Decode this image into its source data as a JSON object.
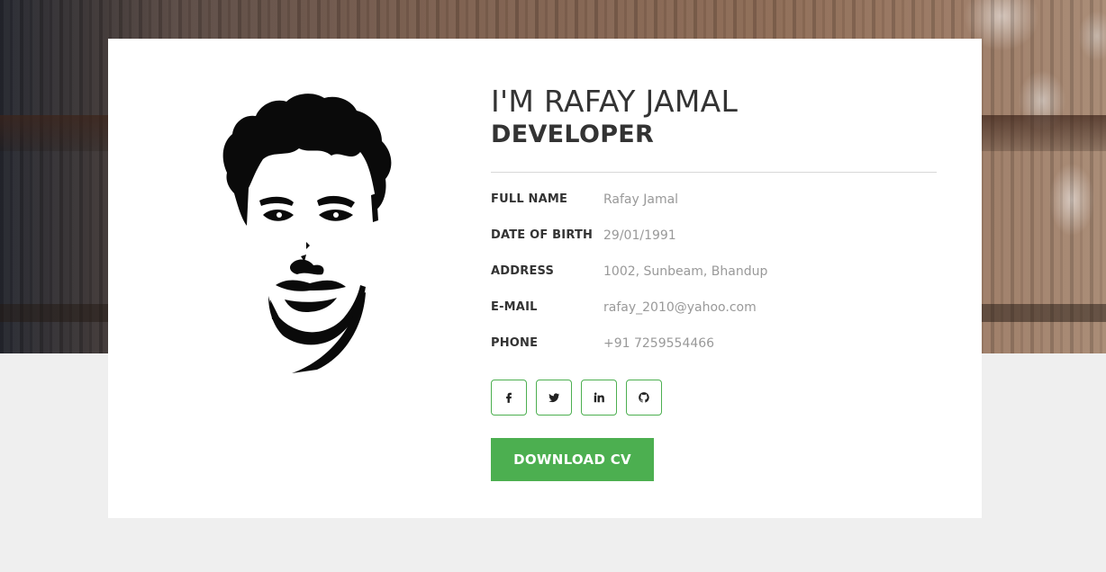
{
  "profile": {
    "title": "I'M RAFAY JAMAL",
    "subtitle": "DEVELOPER"
  },
  "details": [
    {
      "label": "FULL NAME",
      "value": "Rafay Jamal"
    },
    {
      "label": "DATE OF BIRTH",
      "value": "29/01/1991"
    },
    {
      "label": "ADDRESS",
      "value": "1002, Sunbeam, Bhandup"
    },
    {
      "label": "E-MAIL",
      "value": "rafay_2010@yahoo.com"
    },
    {
      "label": "PHONE",
      "value": "+91 7259554466"
    }
  ],
  "socials": [
    {
      "icon": "facebook-icon"
    },
    {
      "icon": "twitter-icon"
    },
    {
      "icon": "linkedin-icon"
    },
    {
      "icon": "github-icon"
    }
  ],
  "actions": {
    "download_cv": "DOWNLOAD CV"
  },
  "colors": {
    "accent": "#4caf50",
    "text": "#333333",
    "muted": "#999999",
    "page_bg": "#efefef"
  }
}
